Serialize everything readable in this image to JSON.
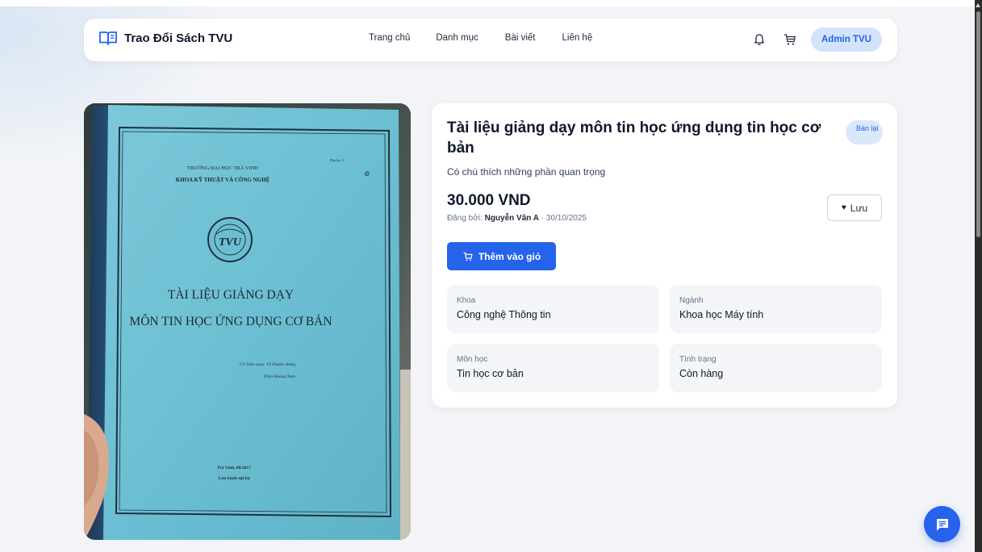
{
  "navbar": {
    "brand": "Trao Đổi Sách TVU",
    "links": [
      "Trang chủ",
      "Danh mục",
      "Bài viết",
      "Liên hệ"
    ],
    "user_button": "Admin TVU",
    "icons": [
      "book-icon",
      "bell-icon",
      "cart-icon"
    ]
  },
  "book_cover": {
    "appendix": "Phụ lục 5",
    "university": "TRƯỜNG ĐẠI HỌC TRÀ VINH",
    "faculty": "KHOA KỸ THUẬT VÀ CÔNG NGHỆ",
    "logo_text": "TVU",
    "title_line1": "TÀI LIỆU GIẢNG DẠY",
    "title_line2": "MÔN TIN HỌC ỨNG DỤNG CƠ BẢN",
    "author_line1": "GV biên soạn: Võ Phước Hưng",
    "author_line2": "Trầm Hoàng Nam",
    "place_date": "Trà Vinh, 08/2017",
    "circulation": "Lưu hành nội bộ"
  },
  "product": {
    "title": "Tài liệu giảng dạy môn tin học ứng dụng tin học cơ bản",
    "badge": "Bán lại",
    "description": "Có chú thích những phần quan trọng",
    "price": "30.000 VND",
    "posted_prefix": "Đăng bởi:",
    "seller": "Nguyễn Văn A",
    "posted_date": "· 30/10/2025",
    "save_label": "Lưu",
    "add_to_cart_label": "Thêm vào giỏ",
    "details": [
      {
        "label": "Khoa",
        "value": "Công nghệ Thông tin"
      },
      {
        "label": "Ngành",
        "value": "Khoa học Máy tính"
      },
      {
        "label": "Môn học",
        "value": "Tin học cơ bản"
      },
      {
        "label": "Tình trạng",
        "value": "Còn hàng"
      }
    ]
  },
  "colors": {
    "accent": "#2563eb",
    "accent_light": "#d4e3fc",
    "page_bg": "#f2f4f7",
    "cover_blue": "#6fc3d6"
  }
}
